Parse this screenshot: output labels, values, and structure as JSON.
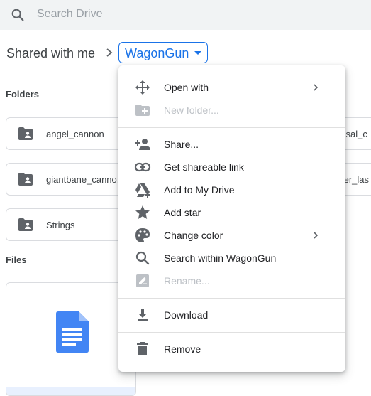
{
  "search": {
    "placeholder": "Search Drive"
  },
  "breadcrumb": {
    "root": "Shared with me",
    "current": "WagonGun"
  },
  "sections": {
    "folders": "Folders",
    "files": "Files"
  },
  "folders": [
    {
      "name": "angel_cannon"
    },
    {
      "name": "giantbane_canno..."
    },
    {
      "name": "Strings"
    }
  ],
  "folders_right_partial": [
    {
      "name": "ssal_c"
    },
    {
      "name": "ter_las"
    }
  ],
  "context_menu": {
    "items": [
      {
        "label": "Open with",
        "icon": "open-with-icon",
        "submenu": true,
        "disabled": false
      },
      {
        "label": "New folder...",
        "icon": "new-folder-icon",
        "submenu": false,
        "disabled": true
      },
      {
        "label": "Share...",
        "icon": "share-person-icon",
        "submenu": false,
        "disabled": false
      },
      {
        "label": "Get shareable link",
        "icon": "link-icon",
        "submenu": false,
        "disabled": false
      },
      {
        "label": "Add to My Drive",
        "icon": "add-to-drive-icon",
        "submenu": false,
        "disabled": false
      },
      {
        "label": "Add star",
        "icon": "star-icon",
        "submenu": false,
        "disabled": false
      },
      {
        "label": "Change color",
        "icon": "palette-icon",
        "submenu": true,
        "disabled": false
      },
      {
        "label": "Search within WagonGun",
        "icon": "search-icon",
        "submenu": false,
        "disabled": false
      },
      {
        "label": "Rename...",
        "icon": "rename-icon",
        "submenu": false,
        "disabled": true
      },
      {
        "label": "Download",
        "icon": "download-icon",
        "submenu": false,
        "disabled": false
      },
      {
        "label": "Remove",
        "icon": "trash-icon",
        "submenu": false,
        "disabled": false
      }
    ]
  },
  "colors": {
    "accent": "#1a73e8",
    "icon": "#5f6368",
    "disabled": "#bdc1c6",
    "doc_blue": "#4285f4"
  }
}
